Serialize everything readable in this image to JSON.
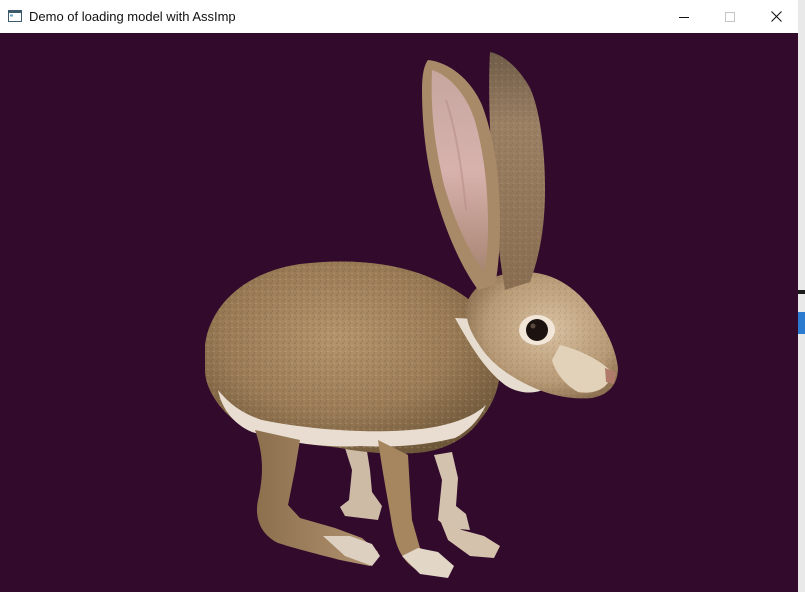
{
  "window": {
    "title": "Demo of loading model with AssImp",
    "controls": [
      "minimize",
      "maximize",
      "close"
    ],
    "background_color": "#310a2c"
  },
  "scene": {
    "model": "rabbit-model"
  }
}
